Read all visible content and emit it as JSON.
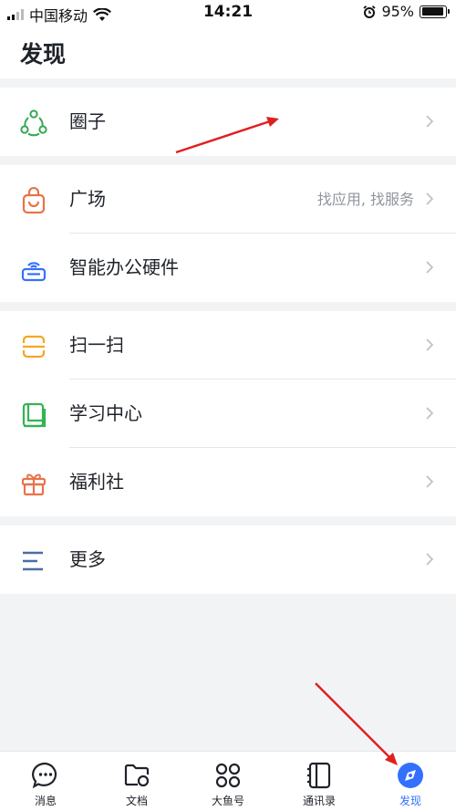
{
  "status_bar": {
    "carrier": "中国移动",
    "time": "14:21",
    "battery": "95%",
    "battery_level": 0.95
  },
  "header": {
    "title": "发现"
  },
  "groups": [
    {
      "rows": [
        {
          "label": "圈子",
          "icon": "circle-community-icon"
        }
      ]
    },
    {
      "rows": [
        {
          "label": "广场",
          "hint": "找应用, 找服务",
          "icon": "shopping-bag-icon"
        },
        {
          "label": "智能办公硬件",
          "icon": "smart-hardware-icon"
        }
      ]
    },
    {
      "rows": [
        {
          "label": "扫一扫",
          "icon": "scan-icon"
        },
        {
          "label": "学习中心",
          "icon": "book-icon"
        },
        {
          "label": "福利社",
          "icon": "gift-icon"
        }
      ]
    },
    {
      "rows": [
        {
          "label": "更多",
          "icon": "menu-lines-icon"
        }
      ]
    }
  ],
  "tabbar": {
    "tabs": [
      {
        "label": "消息",
        "icon": "message-icon"
      },
      {
        "label": "文档",
        "icon": "docs-folder-icon"
      },
      {
        "label": "大鱼号",
        "icon": "grid-apps-icon"
      },
      {
        "label": "通讯录",
        "icon": "contacts-book-icon"
      },
      {
        "label": "发现",
        "icon": "discover-icon",
        "active": true
      }
    ]
  },
  "colors": {
    "accent": "#3370ff",
    "community_green": "#34a853",
    "square_orange": "#e8734a",
    "hardware_blue": "#3370ff",
    "scan_orange": "#f5a623",
    "learn_green": "#34b353",
    "gift_orange": "#e8734a",
    "more_blue": "#4a6fa5",
    "annotation_red": "#e02020"
  }
}
